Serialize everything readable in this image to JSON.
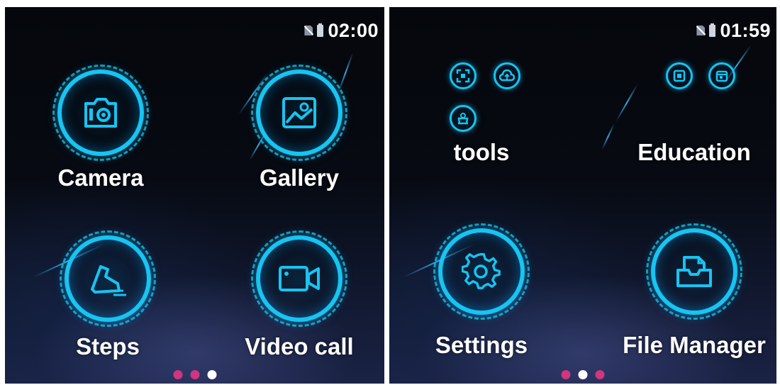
{
  "screens": [
    {
      "status_time": "02:00",
      "apps": [
        {
          "label": "Camera",
          "icon": "camera-icon"
        },
        {
          "label": "Gallery",
          "icon": "gallery-icon"
        },
        {
          "label": "Steps",
          "icon": "shoe-icon"
        },
        {
          "label": "Video call",
          "icon": "video-camera-icon"
        }
      ],
      "page_indicator": {
        "count": 3,
        "active_index": 2
      }
    },
    {
      "status_time": "01:59",
      "folders": [
        {
          "label": "tools",
          "icons": [
            "scan-icon",
            "cloud-upload-icon",
            "weighing-scale-icon"
          ]
        },
        {
          "label": "Education",
          "icons": [
            "calculator-icon",
            "calendar-icon"
          ]
        }
      ],
      "apps": [
        {
          "label": "Settings",
          "icon": "gear-icon"
        },
        {
          "label": "File Manager",
          "icon": "file-tray-icon"
        }
      ],
      "page_indicator": {
        "count": 3,
        "active_index": 1
      }
    }
  ],
  "colors": {
    "accent": "#17c4f2",
    "dot_inactive": "#d0357f",
    "dot_active": "#ffffff",
    "text": "#ffffff"
  }
}
